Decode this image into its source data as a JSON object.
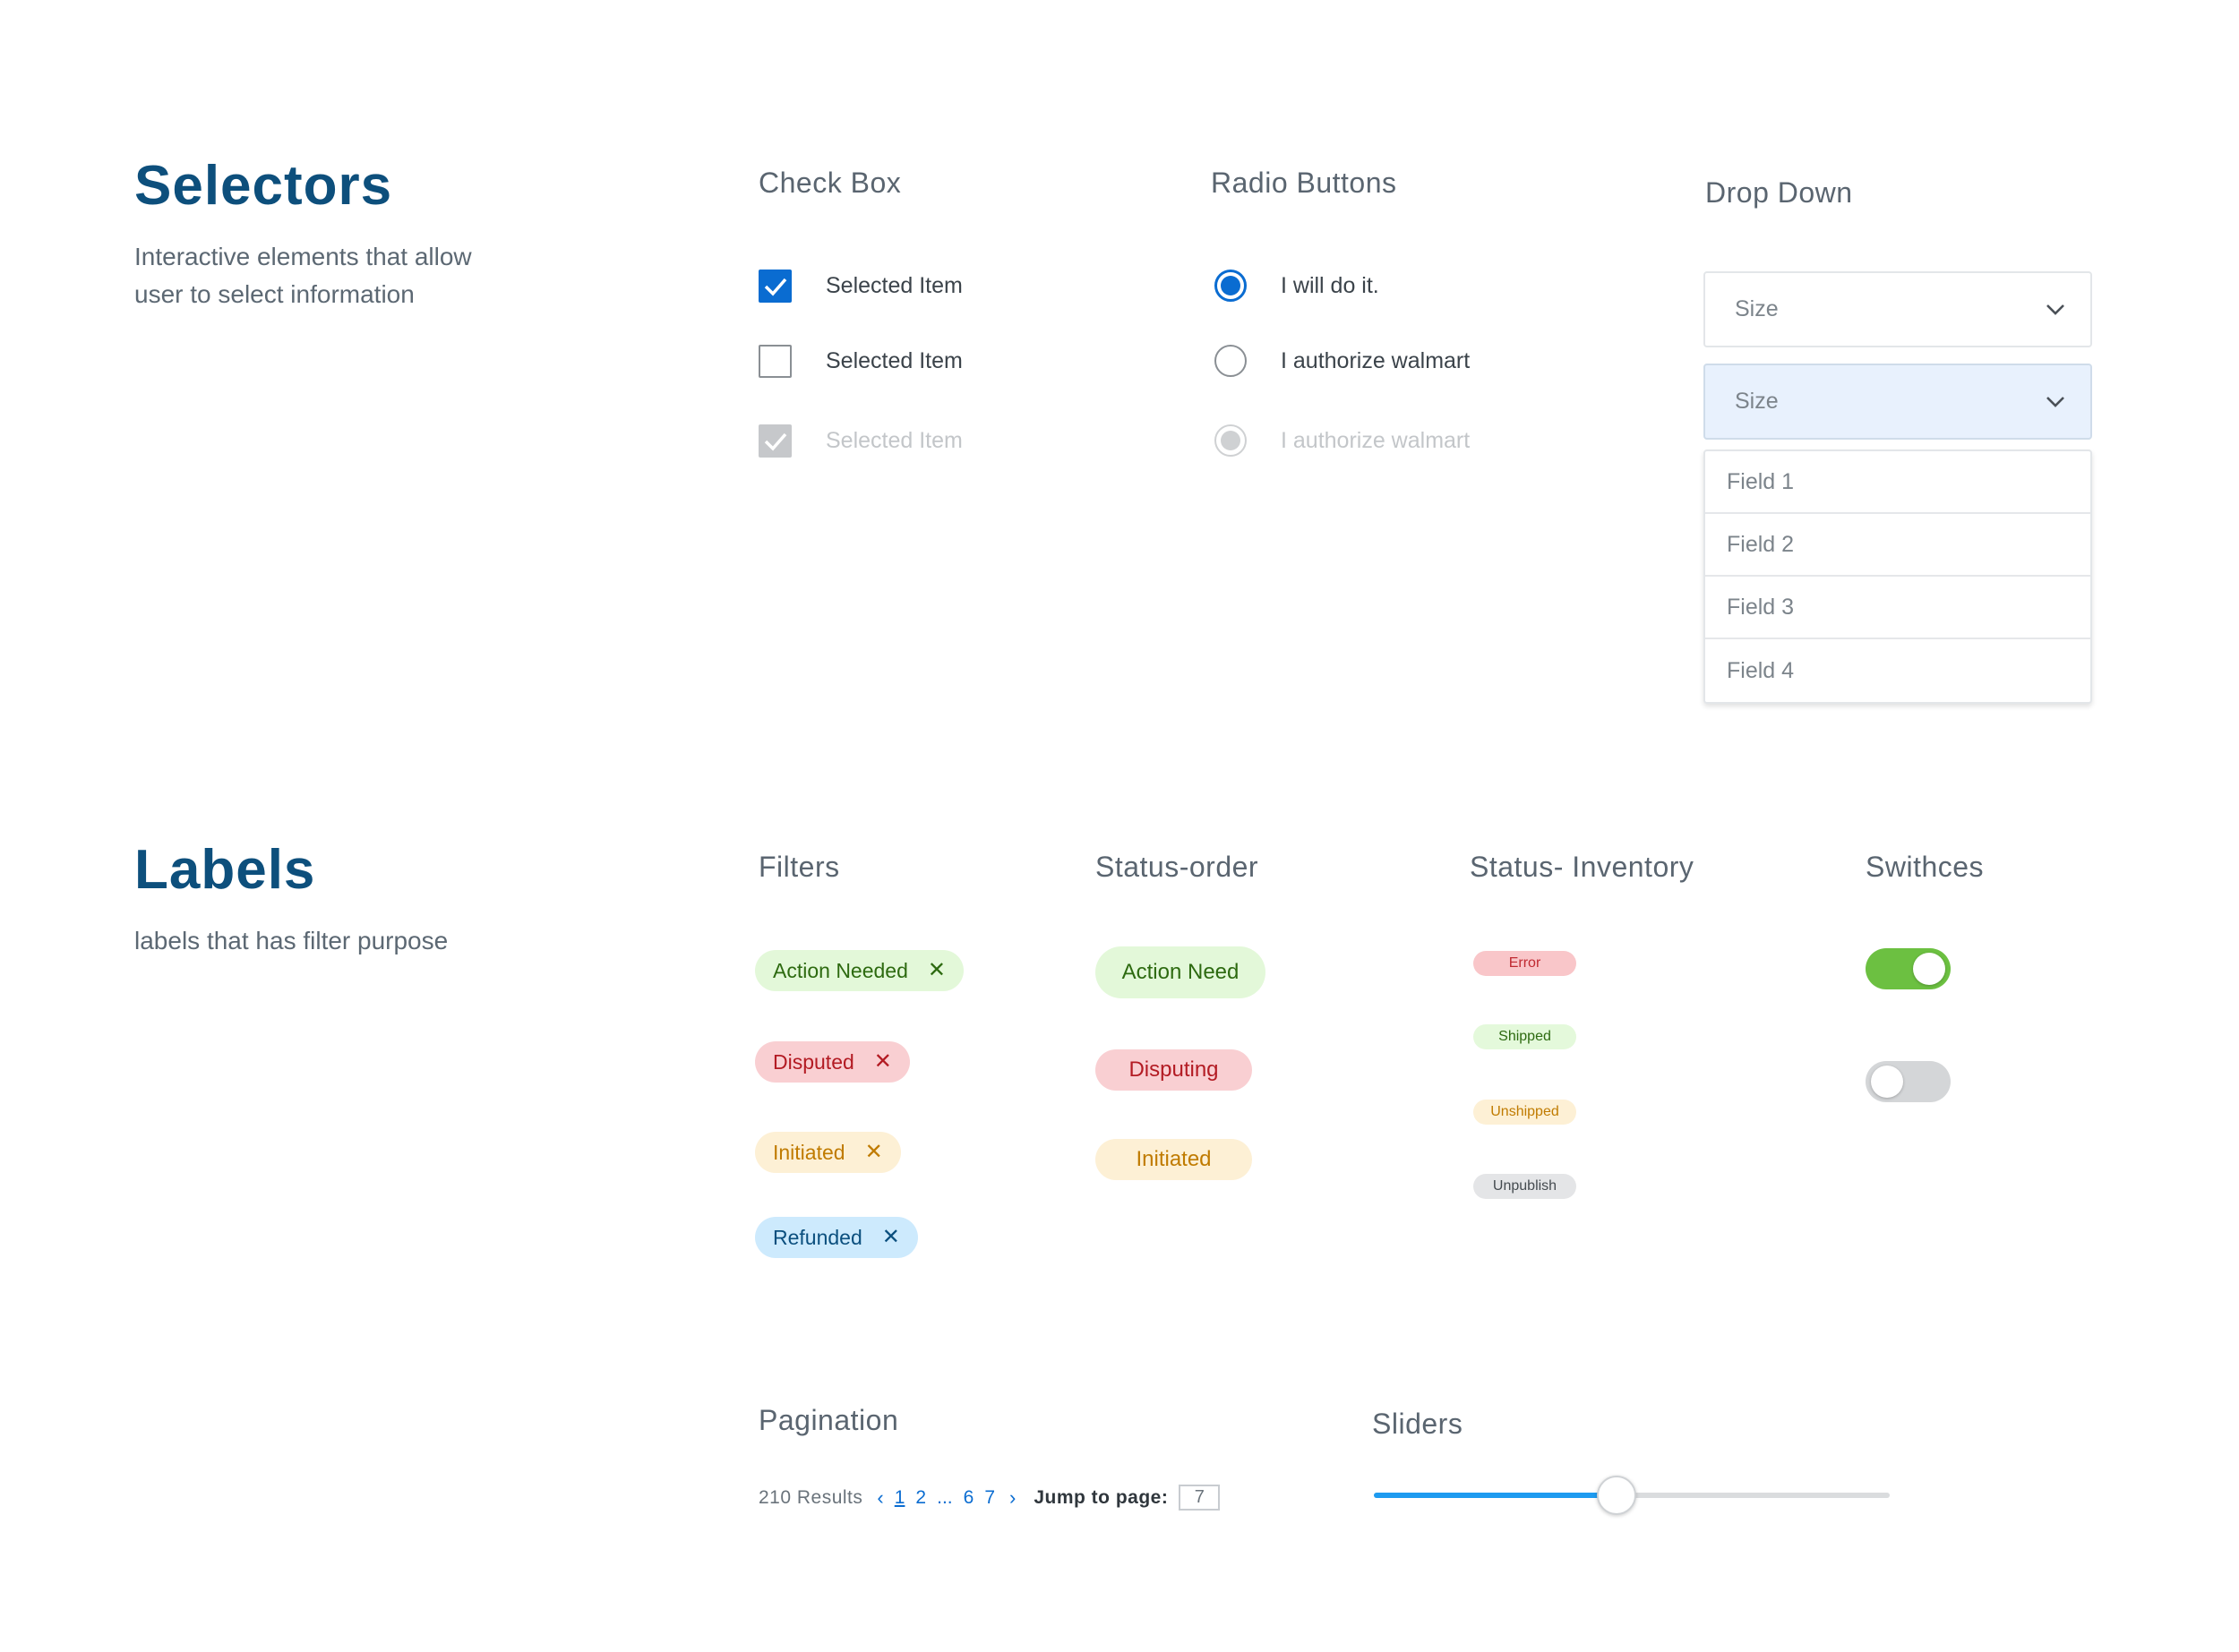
{
  "selectors": {
    "title": "Selectors",
    "description": "Interactive elements that allow user to select information",
    "checkbox": {
      "title": "Check Box",
      "items": [
        {
          "label": "Selected Item",
          "state": "checked"
        },
        {
          "label": "Selected Item",
          "state": "unchecked"
        },
        {
          "label": "Selected Item",
          "state": "disabled-checked"
        }
      ]
    },
    "radio": {
      "title": "Radio Buttons",
      "items": [
        {
          "label": "I will do it.",
          "state": "selected"
        },
        {
          "label": "I authorize walmart",
          "state": "unselected"
        },
        {
          "label": "I authorize walmart",
          "state": "disabled-selected"
        }
      ]
    },
    "dropdown": {
      "title": "Drop Down",
      "closed_value": "Size",
      "open_value": "Size",
      "options": [
        "Field 1",
        "Field 2",
        "Field 3",
        "Field 4"
      ]
    }
  },
  "labels": {
    "title": "Labels",
    "description": "labels that has filter purpose",
    "filters": {
      "title": "Filters",
      "items": [
        {
          "label": "Action Needed",
          "close": "✕",
          "color": "green"
        },
        {
          "label": "Disputed",
          "close": "✕",
          "color": "red"
        },
        {
          "label": "Initiated",
          "close": "✕",
          "color": "yellow"
        },
        {
          "label": "Refunded",
          "close": "✕",
          "color": "blue"
        }
      ]
    },
    "status_order": {
      "title": "Status-order",
      "items": [
        {
          "label": "Action Need",
          "color": "green"
        },
        {
          "label": "Disputing",
          "color": "red"
        },
        {
          "label": "Initiated",
          "color": "yellow"
        }
      ]
    },
    "status_inventory": {
      "title": "Status- Inventory",
      "items": [
        {
          "label": "Error",
          "color": "red"
        },
        {
          "label": "Shipped",
          "color": "green"
        },
        {
          "label": "Unshipped",
          "color": "yellow"
        },
        {
          "label": "Unpublish",
          "color": "grey"
        }
      ]
    },
    "switches": {
      "title": "Swithces",
      "states": [
        "on",
        "off"
      ]
    }
  },
  "pagination": {
    "title": "Pagination",
    "results": "210 Results",
    "prev": "‹",
    "next": "›",
    "pages": [
      "1",
      "2",
      "...",
      "6",
      "7"
    ],
    "current_page": "1",
    "jump_label": "Jump to page:",
    "jump_value": "7"
  },
  "slider": {
    "title": "Sliders",
    "value_fraction": 0.47
  },
  "colors": {
    "brand_blue": "#0a6cd1",
    "heading_blue": "#0d4f7c",
    "switch_on": "#6cc041",
    "slider_fill": "#1e9bf0"
  }
}
